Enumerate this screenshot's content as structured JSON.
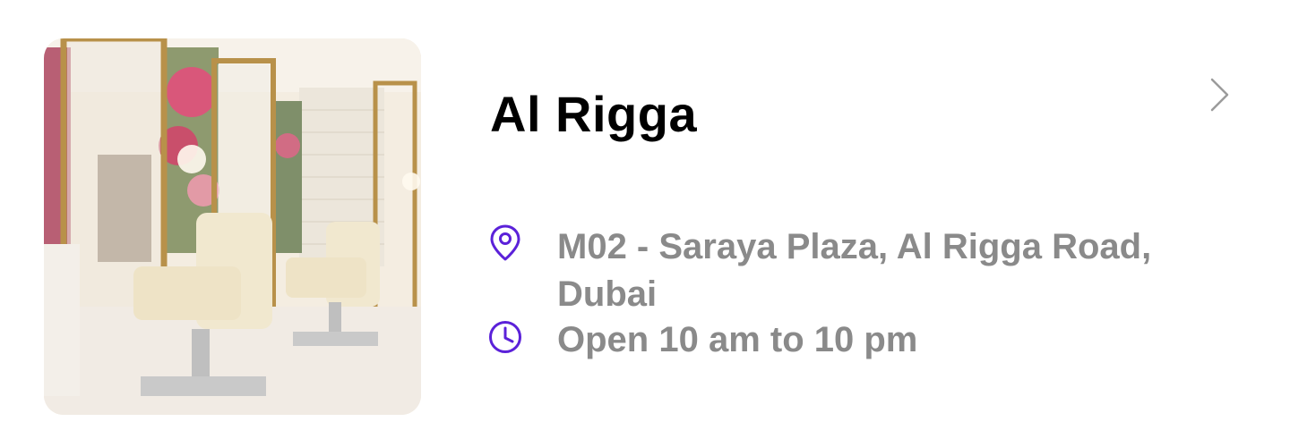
{
  "store": {
    "name": "Al Rigga",
    "address": "M02 - Saraya Plaza, Al Rigga Road, Dubai",
    "hours": "Open 10 am to 10 pm"
  },
  "icons": {
    "location": "map-pin-icon",
    "hours": "clock-icon",
    "navigate": "chevron-right-icon"
  },
  "colors": {
    "accent": "#5b21d9",
    "title": "#000000",
    "secondary_text": "#8a8a8a",
    "chevron": "#9b9b9b"
  }
}
